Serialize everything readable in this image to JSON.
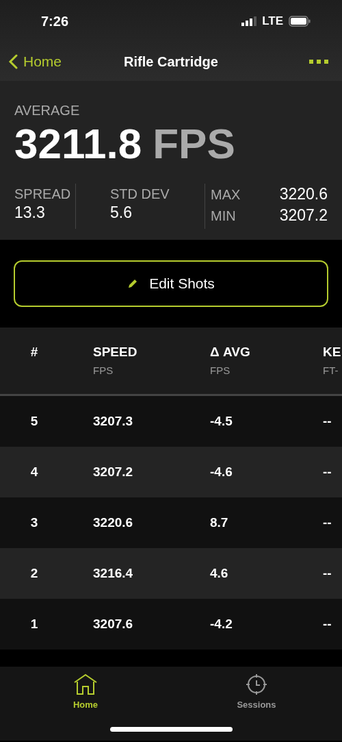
{
  "status_bar": {
    "time": "7:26",
    "network": "LTE"
  },
  "nav": {
    "back": "Home",
    "title": "Rifle Cartridge"
  },
  "summary": {
    "label": "AVERAGE",
    "value": "3211.8",
    "unit": "FPS",
    "stats": [
      {
        "label": "SPREAD",
        "value": "13.3"
      },
      {
        "label": "STD DEV",
        "value": "5.6"
      }
    ],
    "extremes": [
      {
        "label": "MAX",
        "value": "3220.6"
      },
      {
        "label": "MIN",
        "value": "3207.2"
      }
    ]
  },
  "edit_button": "Edit Shots",
  "table": {
    "columns": [
      {
        "title": "#"
      },
      {
        "title": "SPEED",
        "unit": "FPS"
      },
      {
        "title": "Δ AVG",
        "unit": "FPS"
      },
      {
        "title": "KE",
        "unit": "FT-"
      }
    ],
    "rows": [
      [
        "5",
        "3207.3",
        "-4.5",
        "--"
      ],
      [
        "4",
        "3207.2",
        "-4.6",
        "--"
      ],
      [
        "3",
        "3220.6",
        "8.7",
        "--"
      ],
      [
        "2",
        "3216.4",
        "4.6",
        "--"
      ],
      [
        "1",
        "3207.6",
        "-4.2",
        "--"
      ]
    ]
  },
  "tabs": [
    {
      "label": "Home",
      "kind": "home",
      "selected": true
    },
    {
      "label": "Sessions",
      "kind": "sessions",
      "selected": false
    }
  ]
}
